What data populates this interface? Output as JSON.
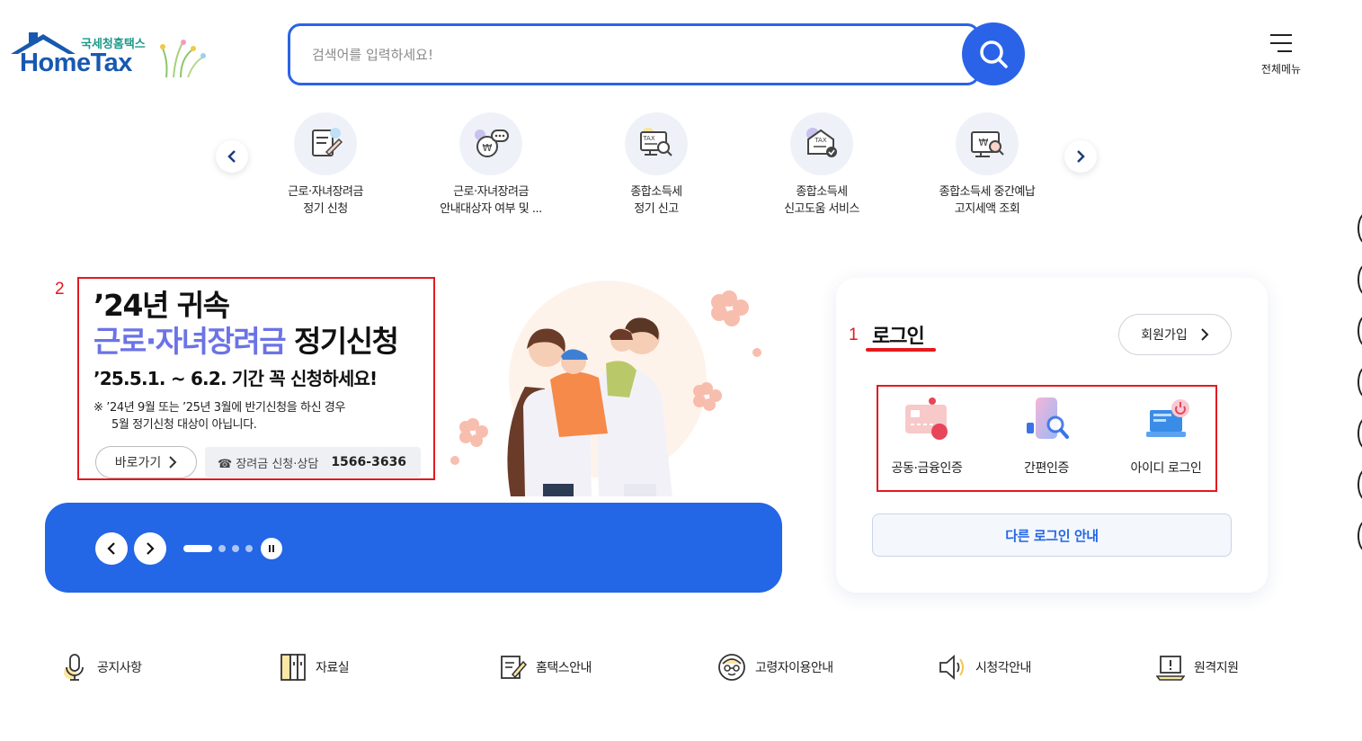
{
  "header": {
    "logo_sub": "국세청홈택스",
    "logo_main": "HomeTax",
    "search_placeholder": "검색어를 입력하세요!",
    "menu_label": "전체메뉴"
  },
  "quick_services": [
    {
      "line1": "근로·자녀장려금",
      "line2": "정기 신청",
      "icon": "document-pen-icon"
    },
    {
      "line1": "근로·자녀장려금",
      "line2": "안내대상자 여부 및 ...",
      "icon": "money-chat-icon"
    },
    {
      "line1": "종합소득세",
      "line2": "정기 신고",
      "icon": "tax-monitor-icon"
    },
    {
      "line1": "종합소득세",
      "line2": "신고도움 서비스",
      "icon": "tax-check-icon"
    },
    {
      "line1": "종합소득세 중간예납",
      "line2": "고지세액 조회",
      "icon": "won-search-icon"
    }
  ],
  "banner": {
    "annotation_number": "2",
    "title_line1": "’24년 귀속",
    "title_highlight": "근로·자녀장려금",
    "title_rest": " 정기신청",
    "period": "’25.5.1. ~ 6.2. 기간 꼭 신청하세요!",
    "note_line1": "※ ’24년 9월 또는 ’25년 3월에 반기신청을 하신 경우",
    "note_line2": "5월 정기신청 대상이 아닙니다.",
    "go_label": "바로가기",
    "phone_label": "☎ 장려금 신청·상담",
    "phone_number": "1566-3636",
    "active_slide": 1,
    "slide_count": 4
  },
  "login": {
    "annotation_number": "1",
    "title": "로그인",
    "join_label": "회원가입",
    "options": [
      {
        "label": "공동·금융인증",
        "icon": "certificate-card-icon"
      },
      {
        "label": "간편인증",
        "icon": "phone-search-icon"
      },
      {
        "label": "아이디 로그인",
        "icon": "laptop-power-icon"
      }
    ],
    "other_label": "다른 로그인 안내"
  },
  "bottom_links": [
    {
      "label": "공지사항",
      "icon": "microphone-icon"
    },
    {
      "label": "자료실",
      "icon": "cabinet-icon"
    },
    {
      "label": "홈택스안내",
      "icon": "guide-pen-icon"
    },
    {
      "label": "고령자이용안내",
      "icon": "elder-face-icon"
    },
    {
      "label": "시청각안내",
      "icon": "speaker-icon"
    },
    {
      "label": "원격지원",
      "icon": "remote-laptop-icon"
    }
  ],
  "colors": {
    "brand_blue": "#2366e6",
    "annotation_red": "#e3191f",
    "highlight_purple": "#6b73e6"
  }
}
